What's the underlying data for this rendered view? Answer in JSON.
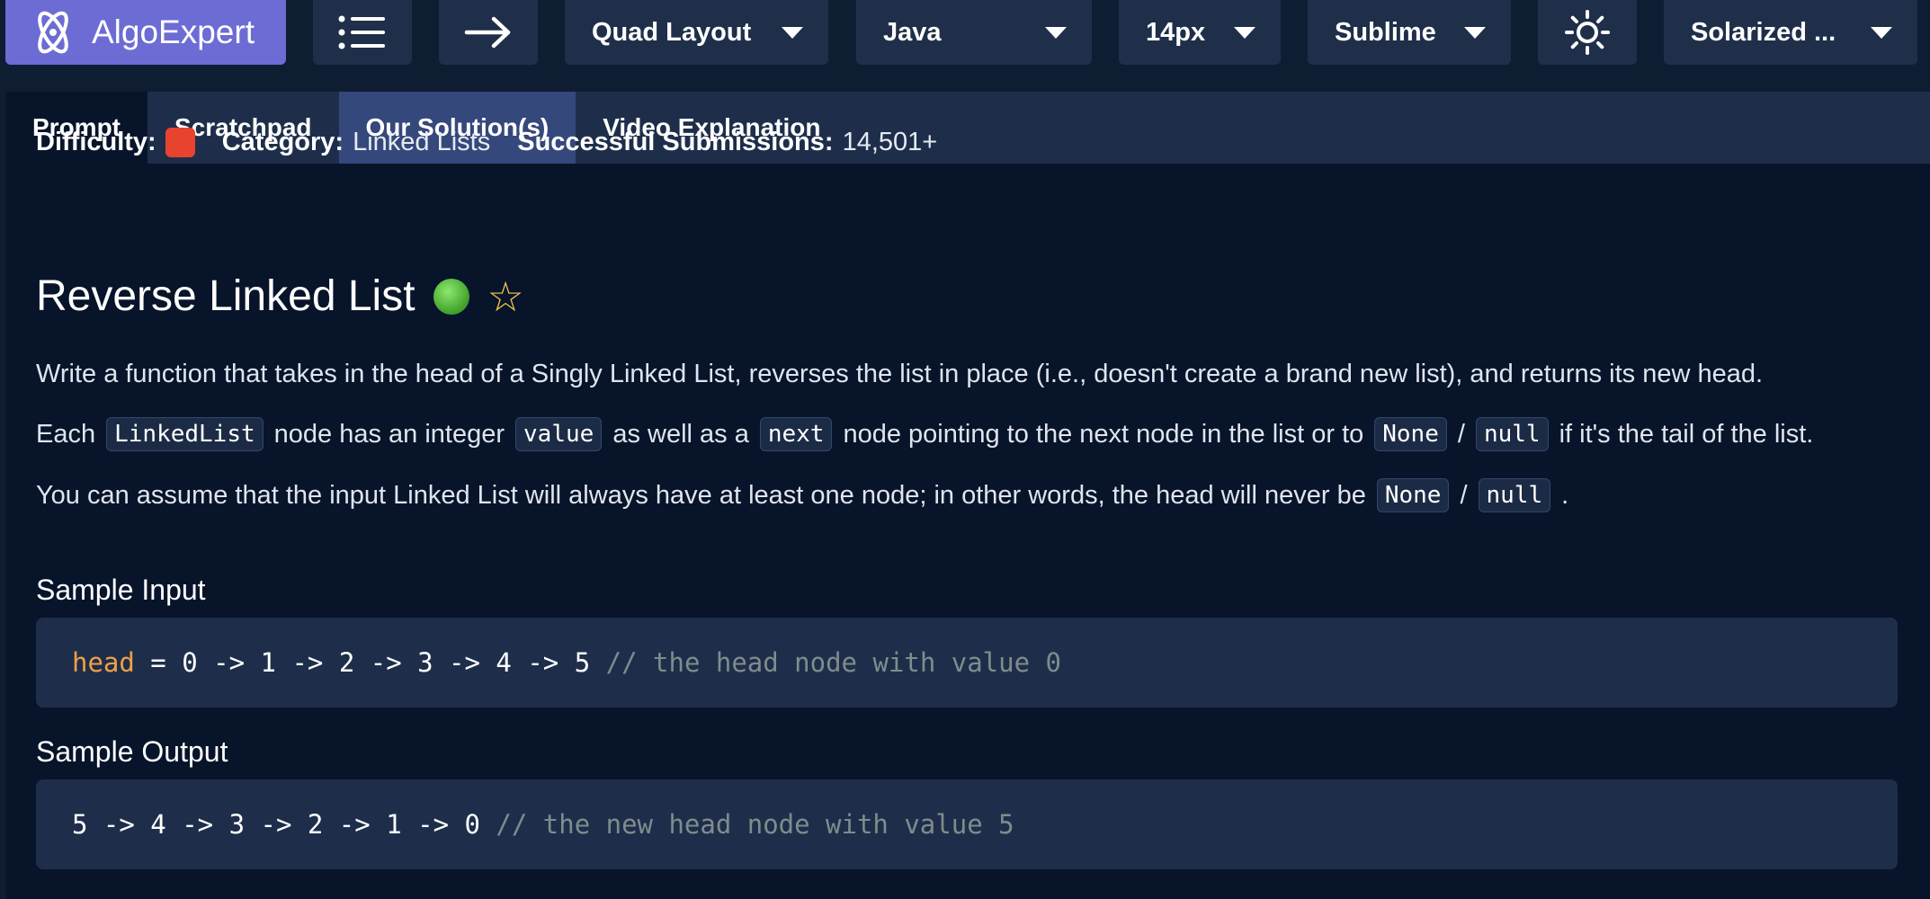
{
  "toolbar": {
    "logo_text": "AlgoExpert",
    "layout": "Quad Layout",
    "language": "Java",
    "font_size": "14px",
    "keymap": "Sublime",
    "theme": "Solarized ..."
  },
  "tabs": [
    {
      "label": "Prompt"
    },
    {
      "label": "Scratchpad"
    },
    {
      "label": "Our Solution(s)"
    },
    {
      "label": "Video Explanation"
    }
  ],
  "meta": {
    "difficulty_label": "Difficulty:",
    "difficulty_color": "#e8432f",
    "category_label": "Category:",
    "category_value": "Linked Lists",
    "submissions_label": "Successful Submissions:",
    "submissions_value": "14,501+"
  },
  "problem": {
    "title": "Reverse Linked List",
    "status_color": "#4caf3a",
    "p1": "Write a function that takes in the head of a Singly Linked List, reverses the list in place (i.e., doesn't create a brand new list), and returns its new head.",
    "p2": {
      "t1": "Each",
      "c1": "LinkedList",
      "t2": "node has an integer",
      "c2": "value",
      "t3": "as well as a",
      "c3": "next",
      "t4": "node pointing to the next node in the list or to",
      "c4": "None",
      "sep": "/",
      "c5": "null",
      "t5": "if it's the tail of the list."
    },
    "p3": {
      "t1": "You can assume that the input Linked List will always have at least one node; in other words, the head will never be",
      "c1": "None",
      "sep": "/",
      "c2": "null",
      "end": "."
    }
  },
  "sample_input": {
    "heading": "Sample Input",
    "var": "head",
    "expr": " = 0 -> 1 -> 2 -> 3 -> 4 -> 5 ",
    "comment": "// the head node with value 0"
  },
  "sample_output": {
    "heading": "Sample Output",
    "expr": "5 -> 4 -> 3 -> 2 -> 1 -> 0 ",
    "comment": "// the new head node with value 5"
  }
}
